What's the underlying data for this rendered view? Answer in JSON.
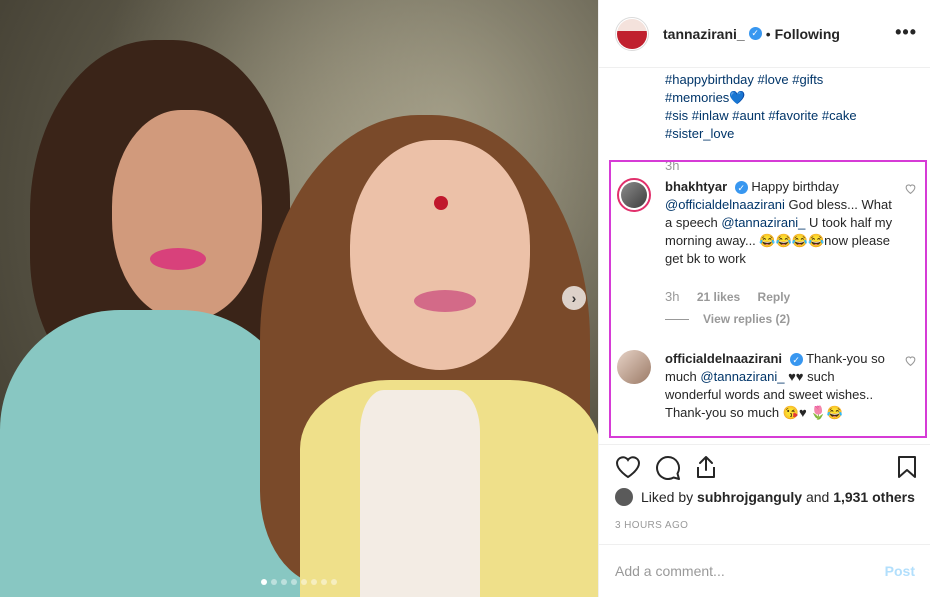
{
  "photo": {
    "next_arrow": "›",
    "carousel_dot_count": 8,
    "active_dot_index": 0
  },
  "header": {
    "username": "tannazirani_",
    "verified_glyph": "✓",
    "separator": "•",
    "follow_label": "Following",
    "more_label": "•••"
  },
  "caption": {
    "tags_line1": [
      "#happybirthday",
      "#love",
      "#gifts"
    ],
    "tags_line2": "#memories",
    "tags_line2_emoji": "💙",
    "tags_line3": [
      "#sis",
      "#inlaw",
      "#aunt",
      "#favorite",
      "#cake"
    ],
    "tags_line4": "#sister_love",
    "time": "3h"
  },
  "comments": [
    {
      "username": "bhakhtyar",
      "text_1": "Happy birthday",
      "mention_1": "@officialdelnaazirani",
      "text_2": "God bless... What a speech",
      "mention_2": "@tannazirani_",
      "text_3": "U took half my morning away... 😂😂😂😂now please get bk to work",
      "time": "3h",
      "likes": "21 likes",
      "reply_label": "Reply",
      "view_replies": "View replies (2)"
    },
    {
      "username": "officialdelnaazirani",
      "text_1": "Thank-you so much",
      "mention_1": "@tannazirani_",
      "text_2": "♥♥ such wonderful words and sweet wishes.. Thank-you so much 😘♥ 🌷😂"
    }
  ],
  "likes": {
    "prefix": "Liked by",
    "user": "subhrojganguly",
    "joiner": "and",
    "others": "1,931 others"
  },
  "timestamp": "3 HOURS AGO",
  "add_comment": {
    "placeholder": "Add a comment...",
    "post_label": "Post"
  },
  "colors": {
    "link": "#003569",
    "verified": "#3897f0",
    "highlight_border": "#d63bd6",
    "post_disabled": "#b2dffc"
  }
}
